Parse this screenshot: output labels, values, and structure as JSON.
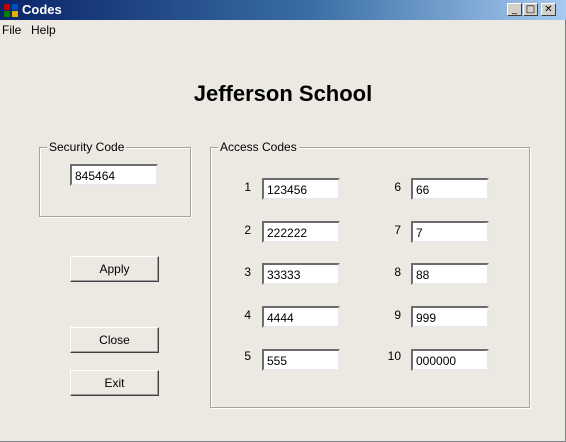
{
  "window": {
    "title": "Codes"
  },
  "menu": {
    "items": [
      "File",
      "Help"
    ]
  },
  "school_title": "Jefferson School",
  "security": {
    "label": "Security Code",
    "value": "845464"
  },
  "access": {
    "label": "Access Codes",
    "codes": [
      {
        "num": "1",
        "value": "123456"
      },
      {
        "num": "2",
        "value": "222222"
      },
      {
        "num": "3",
        "value": "33333"
      },
      {
        "num": "4",
        "value": "4444"
      },
      {
        "num": "5",
        "value": "555"
      },
      {
        "num": "6",
        "value": "66"
      },
      {
        "num": "7",
        "value": "7"
      },
      {
        "num": "8",
        "value": "88"
      },
      {
        "num": "9",
        "value": "999"
      },
      {
        "num": "10",
        "value": "000000"
      }
    ]
  },
  "buttons": {
    "apply": "Apply",
    "close": "Close",
    "exit": "Exit"
  },
  "titlebar_controls": {
    "minimize": "_",
    "maximize": "□",
    "close": "✕"
  },
  "colors": {
    "window_bg": "#ece9e2",
    "titlebar_start": "#0a246a",
    "titlebar_end": "#a6caf0"
  }
}
